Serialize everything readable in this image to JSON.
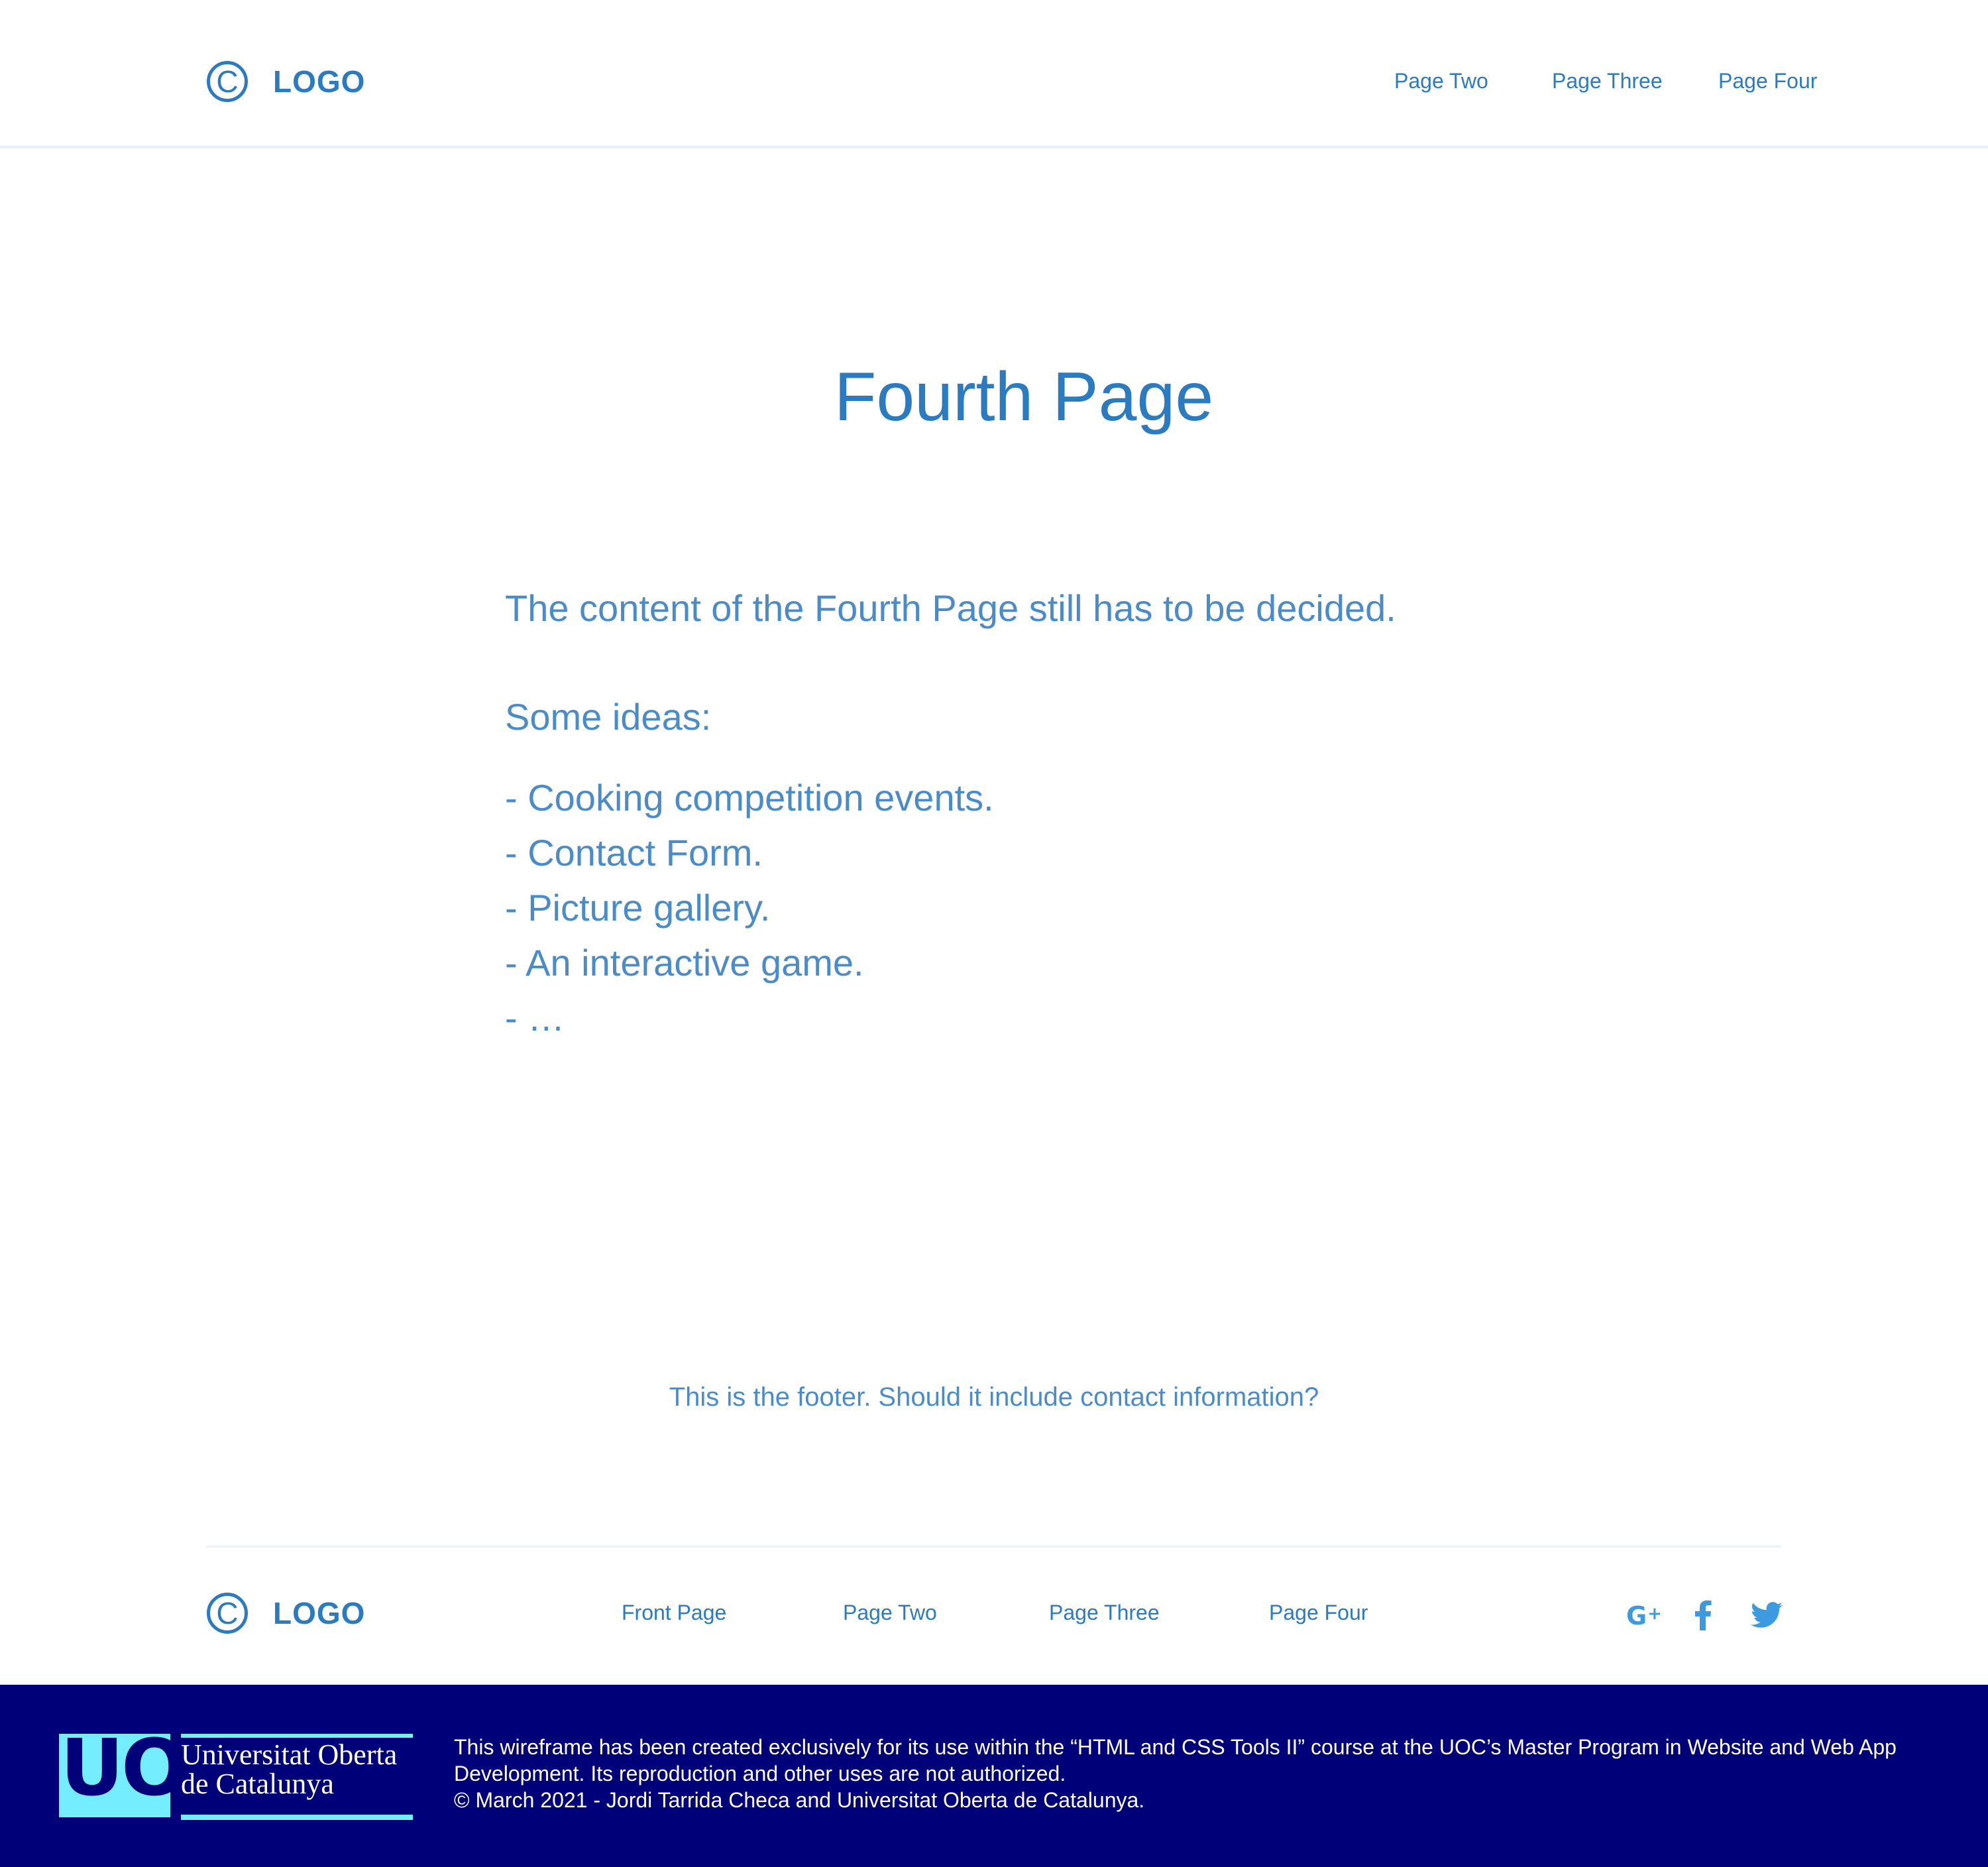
{
  "header": {
    "logo_symbol": "C",
    "logo_text": "LOGO",
    "nav": [
      "Page Two",
      "Page Three",
      "Page Four"
    ]
  },
  "main": {
    "title": "Fourth Page",
    "intro": "The content of the Fourth Page still has to be decided.",
    "ideas_heading": "Some ideas:",
    "ideas": [
      "- Cooking competition events.",
      "- Contact Form.",
      "- Picture gallery.",
      "- An interactive game.",
      "- …"
    ]
  },
  "footer": {
    "note": "This is the footer. Should it include contact information?",
    "logo_symbol": "C",
    "logo_text": "LOGO",
    "nav": [
      "Front Page",
      "Page Two",
      "Page Three",
      "Page Four"
    ],
    "social_icons": [
      "google-plus-icon",
      "facebook-icon",
      "twitter-icon"
    ]
  },
  "credits": {
    "uoc_mark": "UOC",
    "uoc_name_line1": "Universitat Oberta",
    "uoc_name_line2": "de Catalunya",
    "line1": "This wireframe has been created exclusively for its use within the “HTML and CSS Tools II” course at the UOC’s Master Program in Website and Web App Development. Its reproduction and other uses are not authorized.",
    "line2": "© March 2021 - Jordi Tarrida Checa and Universitat Oberta de Catalunya."
  },
  "colors": {
    "primary": "#2b7bc0",
    "text_light": "#4a8cca",
    "social": "#3b9ae0",
    "band": "#000078",
    "uoc_cyan": "#73edff"
  }
}
